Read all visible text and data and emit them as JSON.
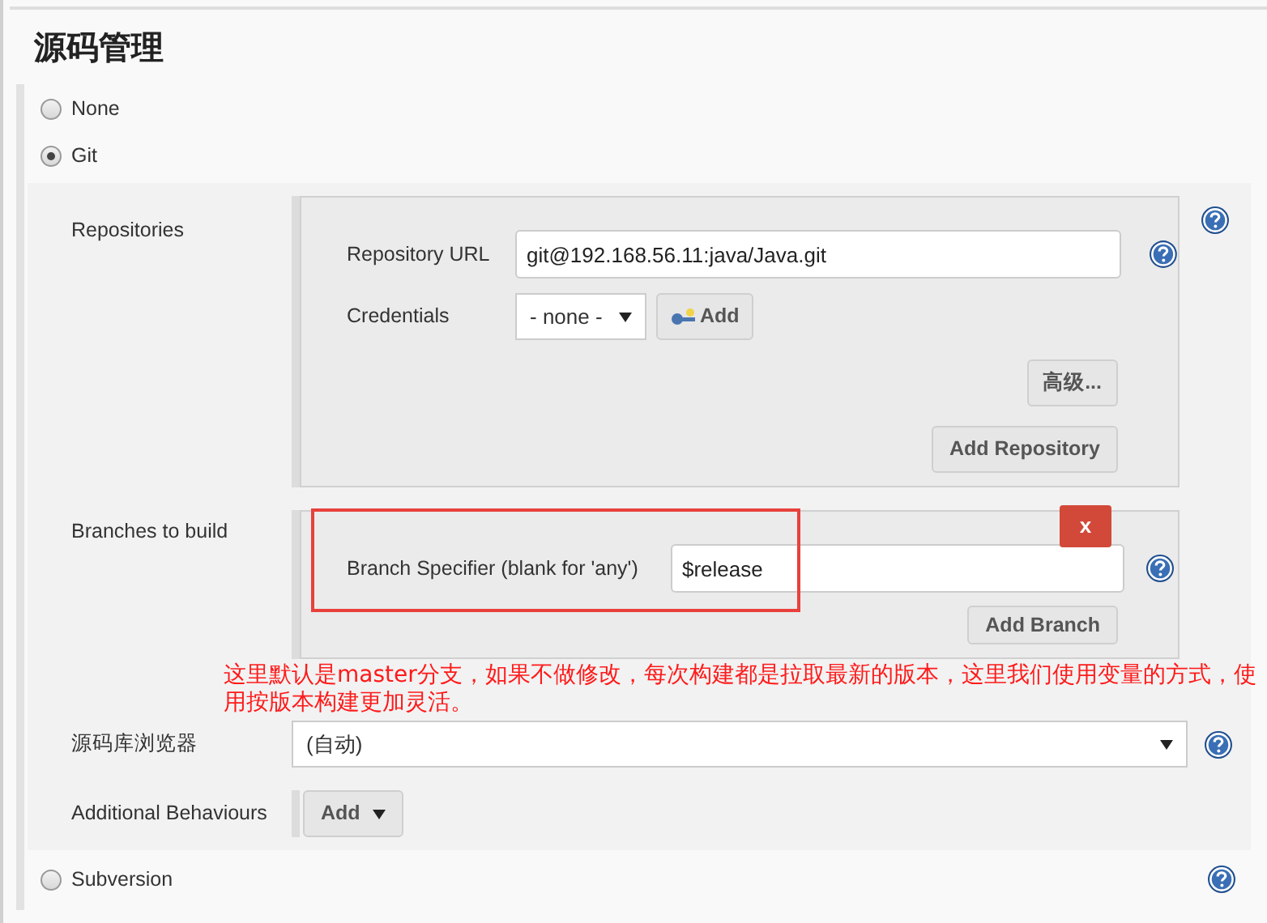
{
  "title": "源码管理",
  "scm_options": [
    {
      "kind": "plain",
      "label": "None",
      "selected": false
    },
    {
      "kind": "git",
      "label": "Git",
      "selected": true
    },
    {
      "kind": "plain",
      "label": "Subversion",
      "selected": false
    }
  ],
  "git": {
    "repositories": {
      "label": "Repositories",
      "url_label": "Repository URL",
      "url": "git@192.168.56.11:java/Java.git",
      "credentials_label": "Credentials",
      "credentials_value": "- none -",
      "add_button": "Add",
      "advanced_button": "高级...",
      "add_repository_button": "Add Repository"
    },
    "branches": {
      "label": "Branches to build",
      "delete_button": "x",
      "specifier_label": "Branch Specifier (blank for 'any')",
      "specifier": "$release",
      "add_branch_button": "Add Branch"
    },
    "browser": {
      "label": "源码库浏览器",
      "value": "(自动)"
    },
    "behaviours": {
      "label": "Additional Behaviours",
      "add_button": "Add"
    }
  },
  "annotation": "这里默认是master分支，如果不做修改，每次构建都是拉取最新的版本，这里我们使用变量的方式，使用按版本构建更加灵活。"
}
